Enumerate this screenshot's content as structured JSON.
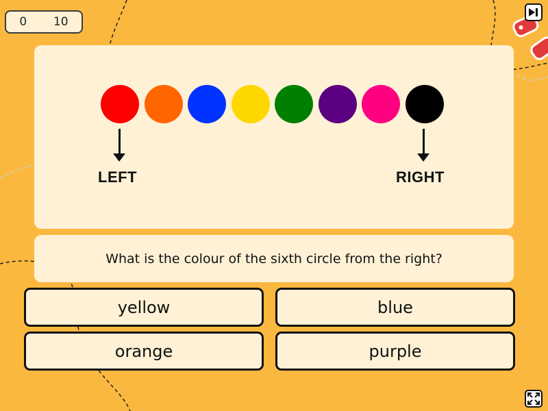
{
  "score": {
    "current": "0",
    "total": "10"
  },
  "colors": {
    "background": "#FBB83F",
    "panel": "#FEF1D6",
    "border": "#111111"
  },
  "circles": [
    {
      "name": "red",
      "color": "#FF0000"
    },
    {
      "name": "orange",
      "color": "#FF6600"
    },
    {
      "name": "blue",
      "color": "#0033FF"
    },
    {
      "name": "yellow",
      "color": "#FFD700"
    },
    {
      "name": "green",
      "color": "#008000"
    },
    {
      "name": "purple",
      "color": "#5B0080"
    },
    {
      "name": "pink",
      "color": "#FF0080"
    },
    {
      "name": "black",
      "color": "#000000"
    }
  ],
  "labels": {
    "left": "LEFT",
    "right": "RIGHT"
  },
  "question": "What is the colour of the sixth circle from the right?",
  "answers": [
    "yellow",
    "blue",
    "orange",
    "purple"
  ],
  "icons": {
    "skip": "skip-forward-icon",
    "fullscreen": "fullscreen-icon"
  }
}
